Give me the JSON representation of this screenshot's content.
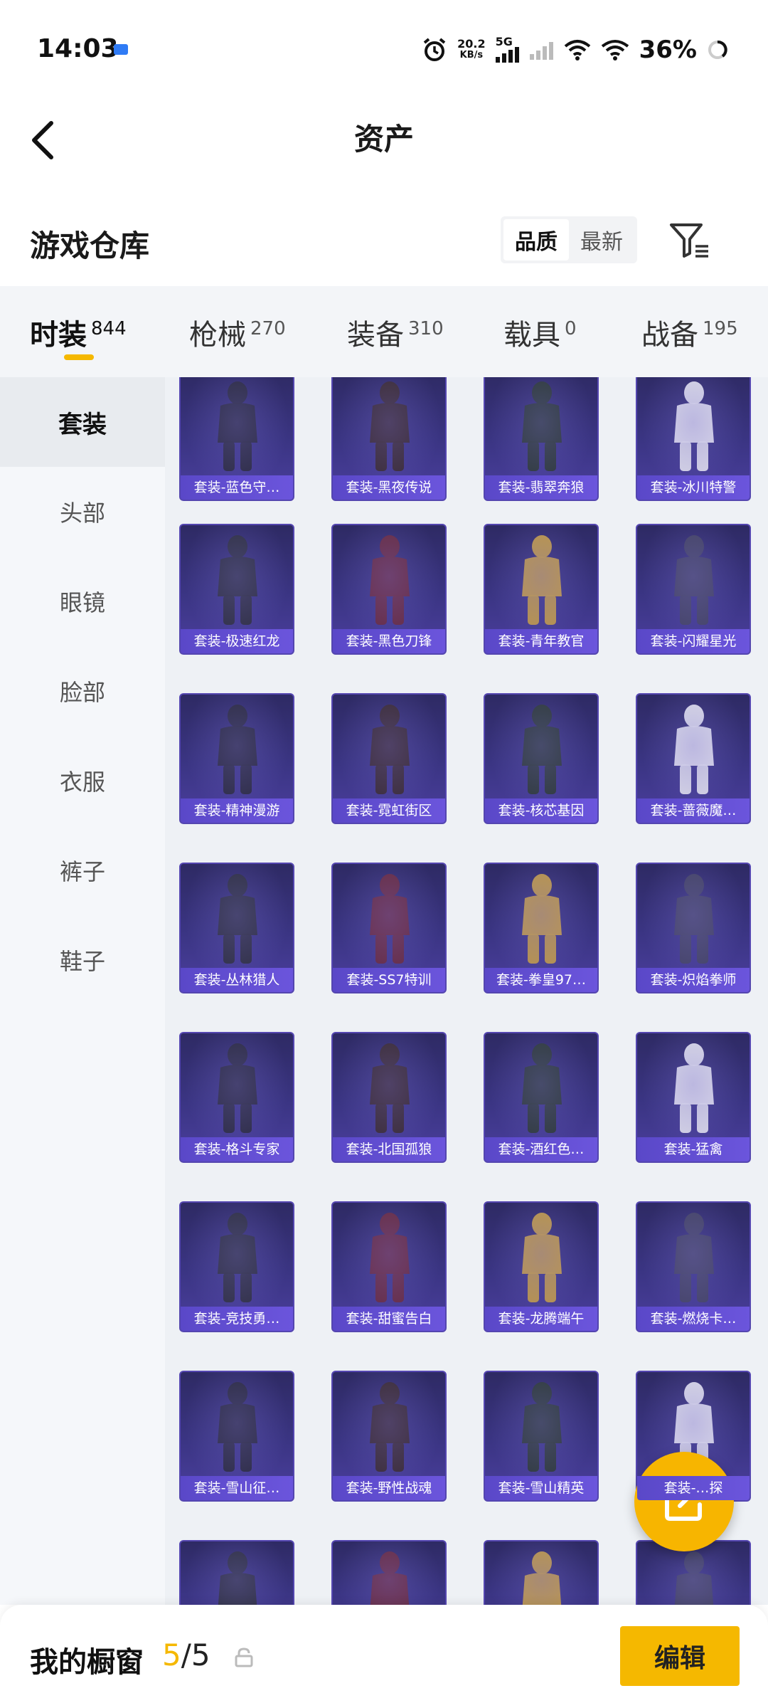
{
  "status_bar": {
    "time": "14:03",
    "net_speed": "20.2",
    "net_unit": "KB/s",
    "network": "5G",
    "battery": "36%",
    "icons": [
      "message-icon",
      "alarm-icon",
      "signal-icon",
      "wifi-icon",
      "hotspot-icon",
      "battery-icon"
    ]
  },
  "header": {
    "title": "资产",
    "back_icon": "chevron-left-icon"
  },
  "warehouse": {
    "title": "游戏仓库",
    "sort_options": [
      "品质",
      "最新"
    ],
    "active_sort": "品质",
    "filter_icon": "filter-icon"
  },
  "tabs": [
    {
      "label": "时装",
      "count": "844"
    },
    {
      "label": "枪械",
      "count": "270"
    },
    {
      "label": "装备",
      "count": "310"
    },
    {
      "label": "载具",
      "count": "0"
    },
    {
      "label": "战备",
      "count": "195"
    }
  ],
  "categories": [
    "套装",
    "头部",
    "眼镜",
    "脸部",
    "衣服",
    "裤子",
    "鞋子"
  ],
  "items": [
    "套装-蓝色守…",
    "套装-黑夜传说",
    "套装-翡翠奔狼",
    "套装-冰川特警",
    "套装-极速红龙",
    "套装-黑色刀锋",
    "套装-青年教官",
    "套装-闪耀星光",
    "套装-精神漫游",
    "套装-霓虹街区",
    "套装-核芯基因",
    "套装-蔷薇魔…",
    "套装-丛林猎人",
    "套装-SS7特训",
    "套装-拳皇97…",
    "套装-炽焰拳师",
    "套装-格斗专家",
    "套装-北国孤狼",
    "套装-酒红色…",
    "套装-猛禽",
    "套装-竞技勇…",
    "套装-甜蜜告白",
    "套装-龙腾端午",
    "套装-燃烧卡…",
    "套装-雪山征…",
    "套装-野性战魂",
    "套装-雪山精英",
    "套装-…探",
    "",
    "",
    "",
    ""
  ],
  "fab_icon": "share-icon",
  "bottom_bar": {
    "title": "我的橱窗",
    "count_current": "5",
    "count_sep": "/5",
    "lock_icon": "lock-icon",
    "edit_label": "编辑"
  },
  "colors": {
    "accent": "#f5b800",
    "card_label": "#6b55dc",
    "card_bg": "#3b3584"
  }
}
